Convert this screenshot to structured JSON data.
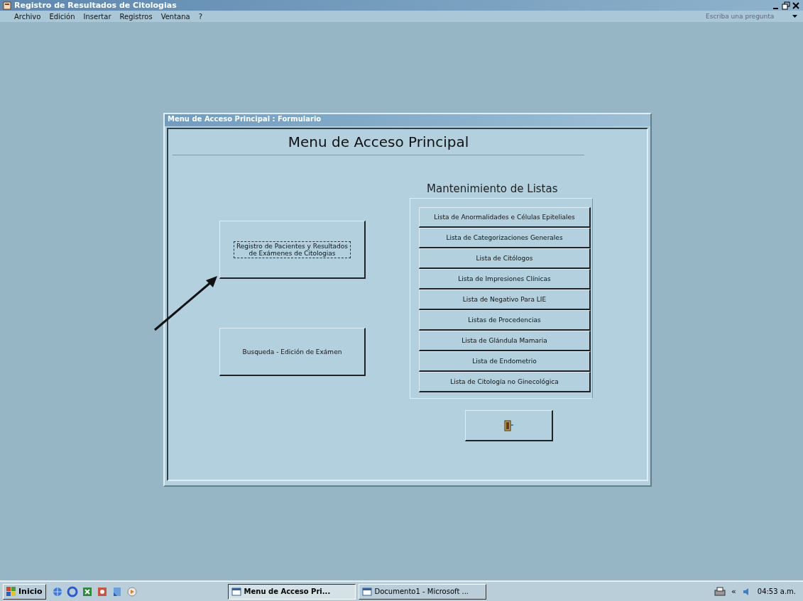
{
  "app_window": {
    "title": "Registro de Resultados de Citologias",
    "menu": [
      "Archivo",
      "Edición",
      "Insertar",
      "Registros",
      "Ventana",
      "?"
    ],
    "help_box": {
      "placeholder": "Escriba una pregunta"
    }
  },
  "form": {
    "title": "Menu de Acceso Principal : Formulario",
    "heading": "Menu de Acceso Principal",
    "main_buttons": [
      {
        "label": "Registro de Pacientes y Resultados\nde Exámenes de Citologias",
        "focused": true
      },
      {
        "label": "Busqueda - Edición de Exámen",
        "focused": false
      }
    ],
    "lists_heading": "Mantenimiento de Listas",
    "list_buttons": [
      "Lista de Anormalidades e Células Epiteliales",
      "Lista de Categorizaciones Generales",
      "Lista de Citólogos",
      "Lista de Impresiones Clínicas",
      "Lista de Negativo Para LIE",
      "Listas de Procedencias",
      "Lista de Glándula Mamaria",
      "Lista de Endometrio",
      "Lista de Citología no Ginecológica"
    ]
  },
  "taskbar": {
    "start": "Inicio",
    "tasks": [
      {
        "label": "Menu de Acceso Pri...",
        "selected": true
      },
      {
        "label": "Documento1 - Microsoft ...",
        "selected": false
      }
    ],
    "tray_chevron": "«",
    "clock": "04:53 a.m."
  }
}
